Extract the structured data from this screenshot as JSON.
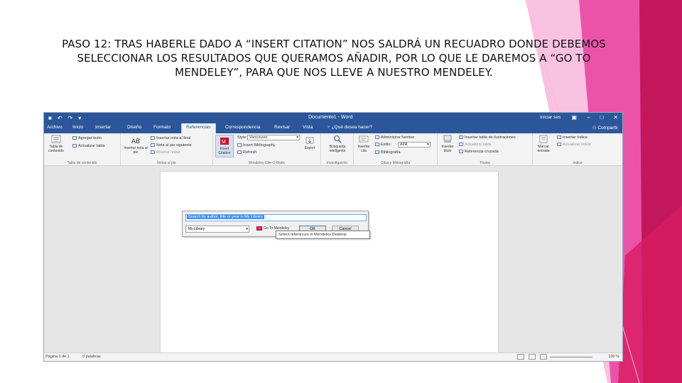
{
  "slide": {
    "title": "PASO 12: TRAS HABERLE DADO A “INSERT CITATION” NOS SALDRÁ UN RECUADRO DONDE DEBEMOS SELECCIONAR LOS RESULTADOS QUE QUERAMOS AÑADIR, POR LO QUE LE DAREMOS A “GO TO MENDELEY”, PARA QUE NOS LLEVE A NUESTRO MENDELEY.",
    "accent_colors": [
      "#c2185b",
      "#e91e8c",
      "#f48fb1"
    ]
  },
  "word": {
    "titlebar": {
      "document": "Documento1 - Word",
      "user": "Iniciar ses",
      "qat": [
        "save-icon",
        "undo-icon",
        "redo-icon",
        "customize-icon"
      ]
    },
    "tabs": [
      "Archivo",
      "Inicio",
      "Insertar",
      "Diseño",
      "Formato",
      "Referencias",
      "Correspondencia",
      "Revisar",
      "Vista",
      "¿Qué desea hacer?"
    ],
    "active_tab": "Referencias",
    "share": "Compartir",
    "ribbon": {
      "toc": {
        "big": "Tabla de contenido",
        "items": [
          "Agregar texto",
          "Actualizar tabla"
        ],
        "group": "Tabla de contenido"
      },
      "footnotes": {
        "big": "Insertar nota al pie",
        "items": [
          "Insertar nota al final",
          "Nota al pie siguiente",
          "Mostrar notas"
        ],
        "group": "Notas al pie"
      },
      "mendeley": {
        "big": "Insert Citation",
        "style_label": "Style:",
        "style_value": "Vancouver",
        "items": [
          "Insert Bibliography",
          "Refresh"
        ],
        "export": "Export",
        "group": "Mendeley Cite-O-Matic"
      },
      "research": {
        "big": "Búsqueda inteligente",
        "group": "Investigación"
      },
      "citations": {
        "big": "Insertar cita",
        "items": [
          "Administrar fuentes",
          "Estilo:",
          "Bibliografía"
        ],
        "style_value": "APA",
        "group": "Citas y bibliografía"
      },
      "captions": {
        "big": "Insertar título",
        "items": [
          "Insertar tabla de ilustraciones",
          "Actualizar tabla",
          "Referencia cruzada"
        ],
        "group": "Títulos"
      },
      "index": {
        "big": "Marcar entrada",
        "items": [
          "Insertar índice",
          "Actualizar índice"
        ],
        "group": "Índice"
      }
    },
    "dialog": {
      "search_text": "Search by author, title or year in My Library",
      "library_select": "My Library",
      "go_to_mendeley": "Go To Mendeley",
      "ok": "OK",
      "cancel": "Cancel",
      "tooltip": "Select references in Mendeley Desktop"
    },
    "status": {
      "page": "Página 1 de 1",
      "words": "0 palabras",
      "zoom": "100 %"
    }
  }
}
